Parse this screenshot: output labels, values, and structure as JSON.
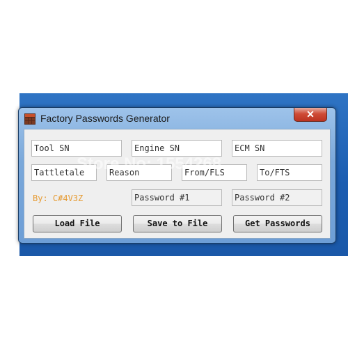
{
  "window": {
    "title": "Factory Passwords Generator",
    "close_label": "✕",
    "icon": "calculator-grid-icon"
  },
  "fields": {
    "tool_sn": "Tool SN",
    "engine_sn": "Engine SN",
    "ecm_sn": "ECM SN",
    "tattletale": "Tattletale",
    "reason": "Reason",
    "from_fls": "From/FLS",
    "to_fts": "To/FTS",
    "password1": "Password #1",
    "password2": "Password #2"
  },
  "author": "By: C#4V3Z",
  "buttons": {
    "load": "Load File",
    "save": "Save to File",
    "get": "Get Passwords"
  },
  "watermark": "Store No: 1554268",
  "colors": {
    "desktop": "#1b5db1",
    "author": "#e69b33",
    "close": "#c9402c"
  }
}
